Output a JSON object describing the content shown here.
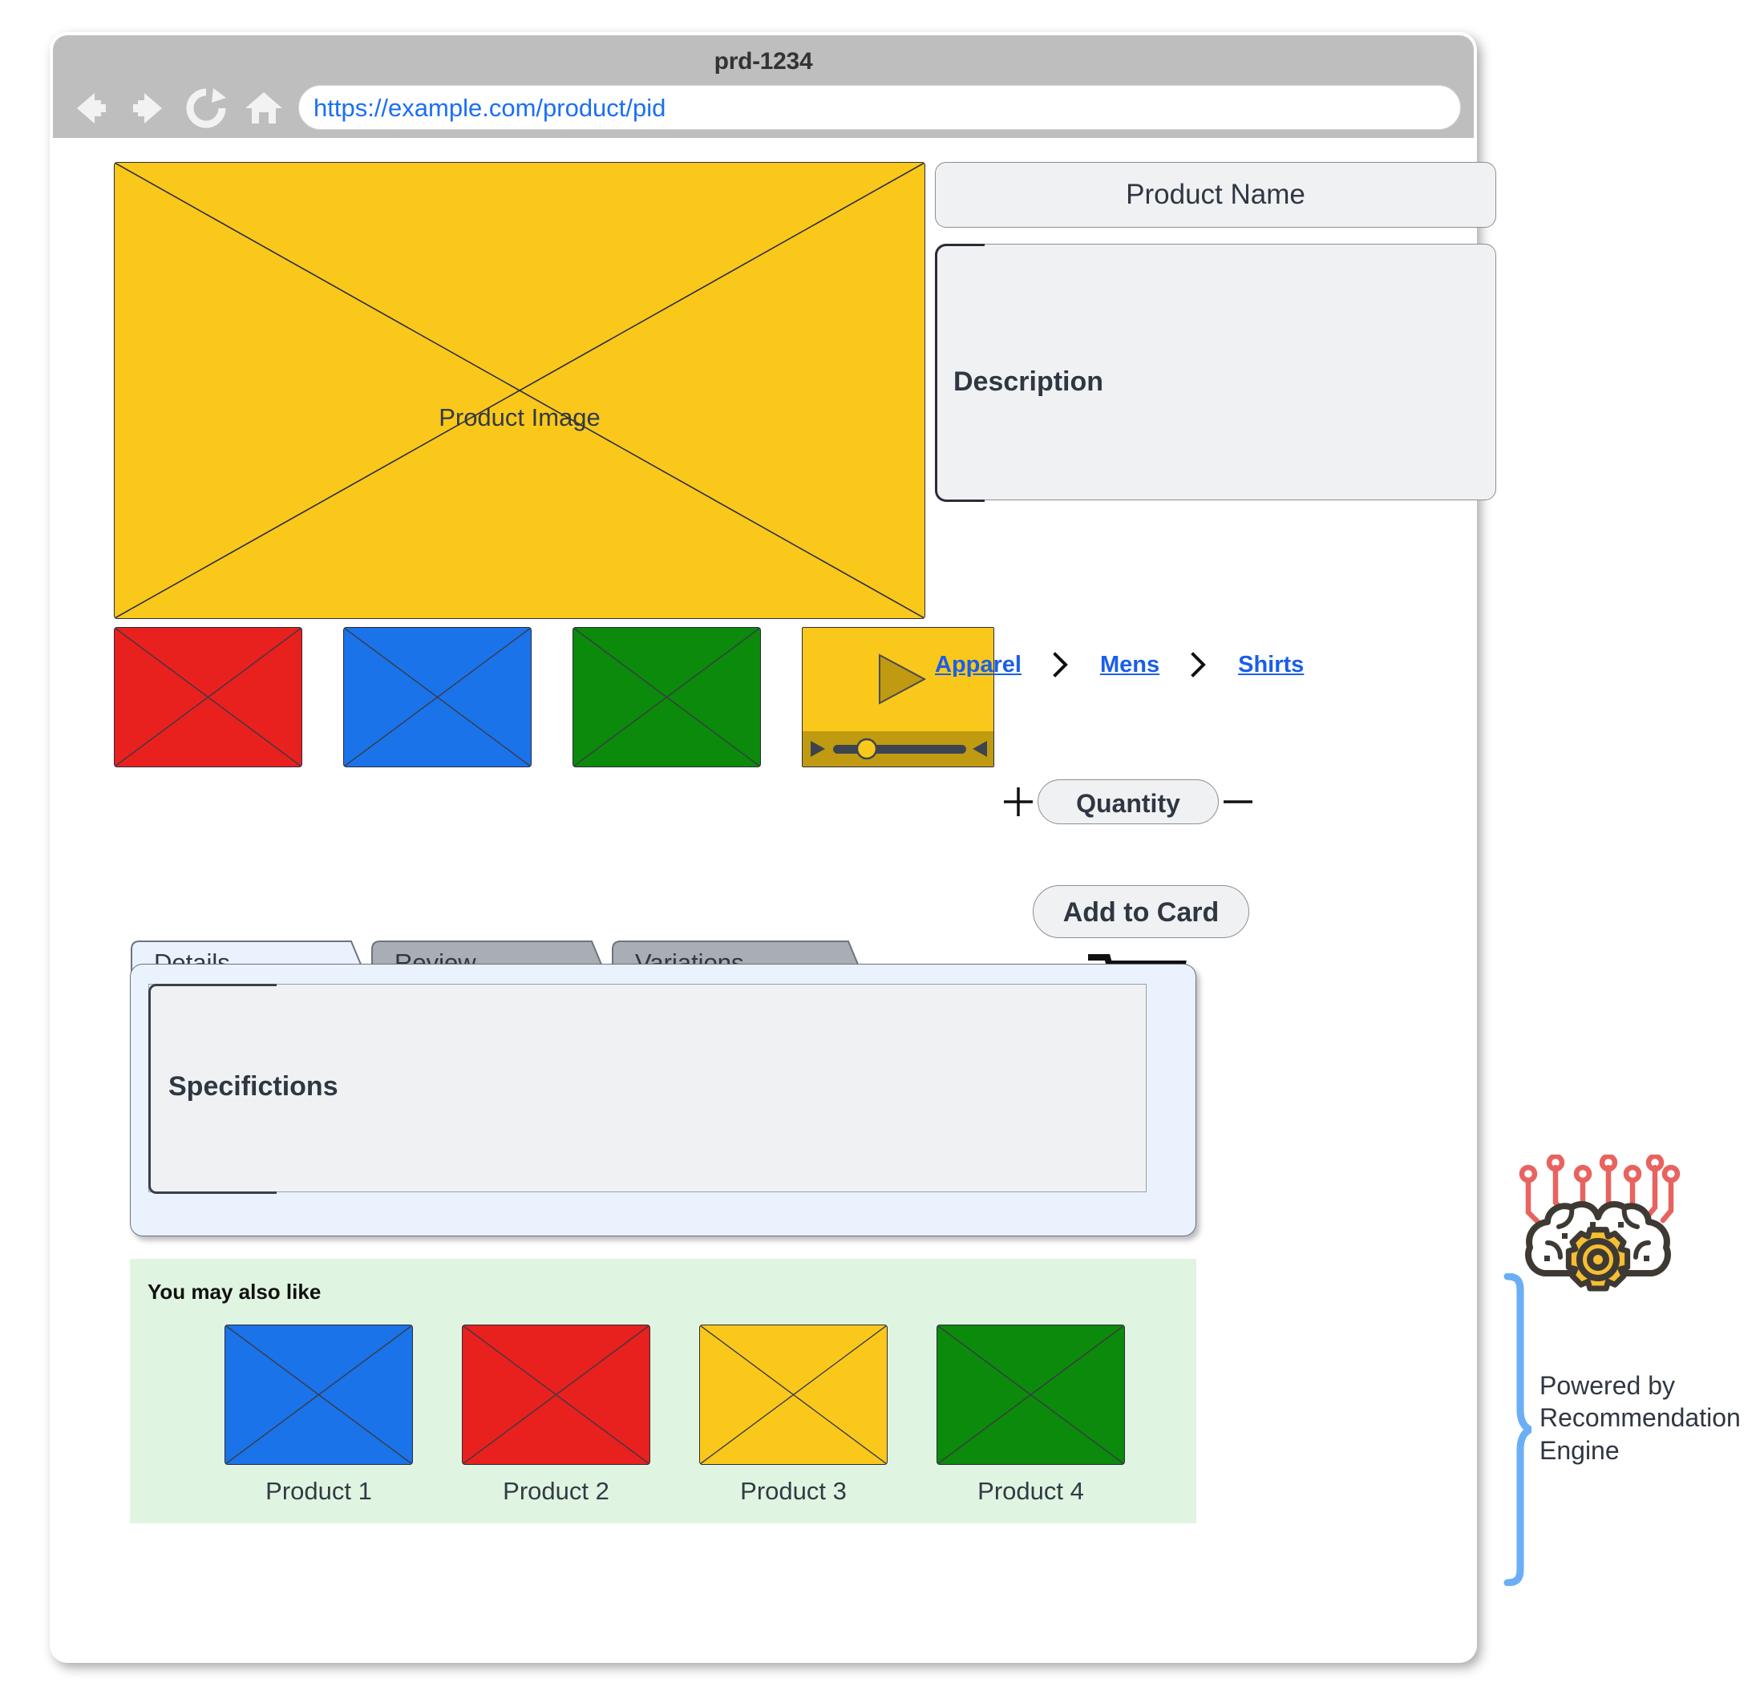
{
  "browser": {
    "window_title": "prd-1234",
    "url": "https://example.com/product/pid",
    "nav": {
      "back": "back-arrow",
      "forward": "forward-arrow",
      "reload": "reload-icon",
      "home": "home-icon"
    }
  },
  "product": {
    "main_image_label": "Product Image",
    "main_image_color": "#F9C81B",
    "name_label": "Product Name",
    "description_label": "Description",
    "thumbnails": [
      {
        "label": "thumbnail-red",
        "color": "#E8201E"
      },
      {
        "label": "thumbnail-blue",
        "color": "#1A73E8"
      },
      {
        "label": "thumbnail-green",
        "color": "#0B8A0B"
      }
    ],
    "video": {
      "label": "product-video",
      "color": "#F9C81B",
      "control_bar_color": "#C09A10",
      "play_icon": "play-triangle-icon",
      "speaker_icon": "speaker-icon",
      "progress_knob_color": "#F9C81B"
    }
  },
  "breadcrumb": {
    "items": [
      "Apparel",
      "Mens",
      "Shirts"
    ],
    "separator_icon": "chevron-right-icon",
    "link_color": "#1a5fe8"
  },
  "purchase": {
    "increase_label": "+",
    "decrease_label": "—",
    "quantity_label": "Quantity",
    "add_to_cart_label": "Add to Card",
    "cart_icon": "shopping-cart-icon"
  },
  "tabs": {
    "items": [
      {
        "label": "Details",
        "active": true
      },
      {
        "label": "Review",
        "active": false
      },
      {
        "label": "Variations",
        "active": false
      }
    ],
    "active_bg": "#eaf2fd",
    "inactive_bg": "#a9adb4",
    "panel_content_label": "Specifictions"
  },
  "recommendations": {
    "title": "You may also like",
    "panel_color": "#e0f5e1",
    "items": [
      {
        "label": "Product 1",
        "color": "#1A73E8"
      },
      {
        "label": "Product 2",
        "color": "#E8201E"
      },
      {
        "label": "Product 3",
        "color": "#F9C81B"
      },
      {
        "label": "Product 4",
        "color": "#0B8A0B"
      }
    ]
  },
  "callout": {
    "text": "Powered by Recommendation Engine",
    "icon": "ai-brain-gear-icon",
    "brace_icon": "curly-brace-icon",
    "brace_color": "#6BAEF5",
    "gear_color": "#F5BE33",
    "node_color": "#E8635F",
    "brain_color": "#3E3A33"
  }
}
